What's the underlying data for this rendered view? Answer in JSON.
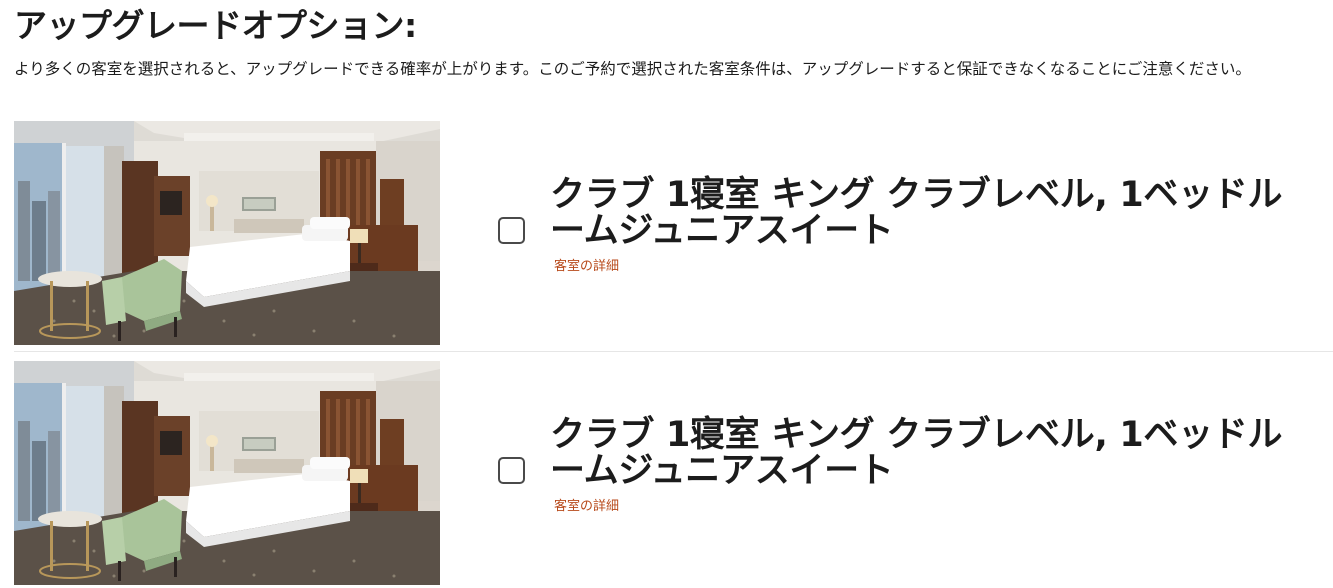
{
  "header": {
    "title": "アップグレードオプション:",
    "description": "より多くの客室を選択されると、アップグレードできる確率が上がります。このご予約で選択された客室条件は、アップグレードすると保証できなくなることにご注意ください。"
  },
  "rooms": [
    {
      "name": "クラブ 1寝室 キング クラブレベル, 1ベッドルームジュニアスイート",
      "details_link": "客室の詳細",
      "checked": false
    },
    {
      "name": "クラブ 1寝室 キング クラブレベル, 1ベッドルームジュニアスイート",
      "details_link": "客室の詳細",
      "checked": false
    }
  ],
  "colors": {
    "link": "#b84a1b",
    "text": "#1c1c1c",
    "checkbox_border": "#4a4a4a"
  }
}
